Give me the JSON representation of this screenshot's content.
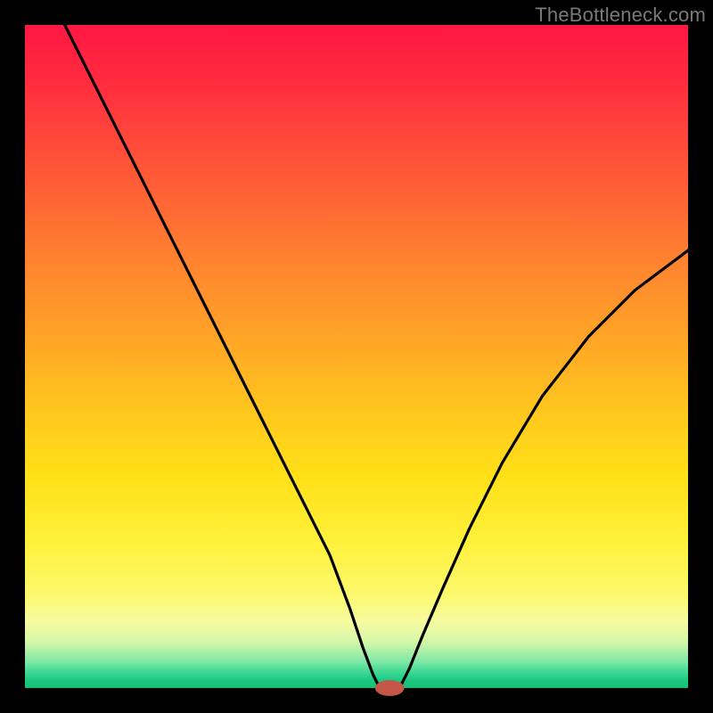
{
  "watermark": "TheBottleneck.com",
  "colors": {
    "frame": "#000000",
    "curve": "#000000",
    "marker": "#c55546",
    "gradient_top": "#ff1744",
    "gradient_mid": "#ffe018",
    "gradient_bottom": "#15bf74"
  },
  "chart_data": {
    "type": "line",
    "title": "",
    "xlabel": "",
    "ylabel": "",
    "xlim": [
      0,
      100
    ],
    "ylim": [
      0,
      100
    ],
    "grid": false,
    "legend": false,
    "annotations": [],
    "series": [
      {
        "name": "left-branch",
        "x": [
          6,
          10,
          14,
          18,
          22,
          26,
          30,
          34,
          38,
          42,
          46,
          49,
          51,
          52.5,
          53.5
        ],
        "y": [
          100,
          92,
          84,
          76,
          68,
          60,
          52,
          44,
          36,
          28,
          20,
          12,
          6,
          2,
          0
        ]
      },
      {
        "name": "floor",
        "x": [
          53.5,
          56.5
        ],
        "y": [
          0,
          0
        ]
      },
      {
        "name": "right-branch",
        "x": [
          56.5,
          58,
          60,
          63,
          67,
          72,
          78,
          85,
          92,
          100
        ],
        "y": [
          0,
          3,
          8,
          15,
          24,
          34,
          44,
          53,
          60,
          66
        ]
      }
    ],
    "marker": {
      "x": 55,
      "y": 0,
      "rx": 2.2,
      "ry": 1.2
    }
  }
}
